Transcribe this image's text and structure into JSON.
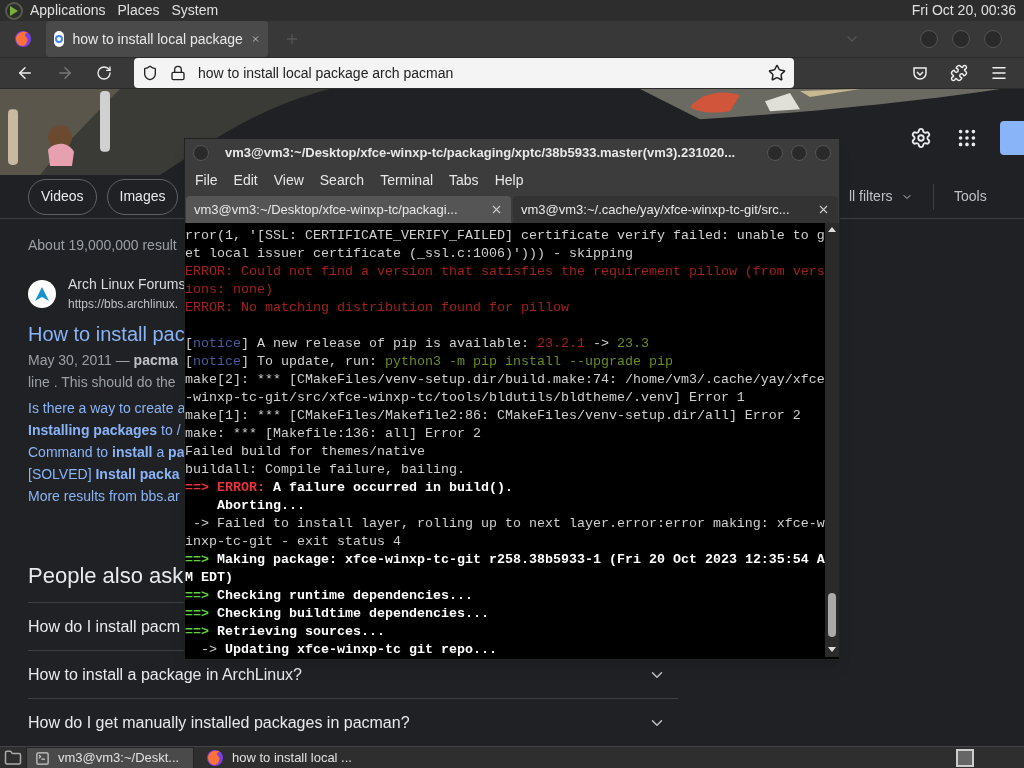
{
  "top_panel": {
    "menus": [
      "Applications",
      "Places",
      "System"
    ],
    "clock": "Fri Oct 20, 00:36"
  },
  "browser": {
    "tab": {
      "title": "how to install local package"
    },
    "address": {
      "value": "how to install local package arch pacman"
    },
    "search_tabs": [
      "Videos",
      "Images"
    ],
    "filters": [
      "ll filters",
      "Tools"
    ],
    "results_count": "About 19,000,000 result",
    "result": {
      "site": "Arch Linux Forums",
      "url": "https://bbs.archlinux.",
      "title": "How to install pac",
      "snippet": [
        "May 30, 2011 — **pacma**",
        "line . This should do the"
      ],
      "links": [
        "Is there a way to create a",
        "**Installing packages** to /",
        "Command to **install** a **pa**",
        "[SOLVED] **Install packa**",
        "More results from bbs.ar"
      ]
    },
    "people_also_ask": {
      "title": "People also ask",
      "questions": [
        {
          "text": "How do I install pacm",
          "chevron": false
        },
        {
          "text": "How to install a package in ArchLinux?",
          "chevron": true
        },
        {
          "text": "How do I get manually installed packages in pacman?",
          "chevron": true
        }
      ]
    }
  },
  "terminal": {
    "title": "vm3@vm3:~/Desktop/xfce-winxp-tc/packaging/xptc/38b5933.master(vm3).231020...",
    "menus": [
      "File",
      "Edit",
      "View",
      "Search",
      "Terminal",
      "Tabs",
      "Help"
    ],
    "tabs": [
      {
        "label": "vm3@vm3:~/Desktop/xfce-winxp-tc/packagi...",
        "selected": false
      },
      {
        "label": "vm3@vm3:~/.cache/yay/xfce-winxp-tc-git/src...",
        "selected": true
      }
    ],
    "blocks": [
      [
        [
          {
            "text": "rror(1, '[SSL: CERTIFICATE_VERIFY_FAILED] certificate verify failed: unable to g",
            "kind": "plain"
          }
        ],
        [
          {
            "text": "et local issuer certificate (_ssl.c:1006)'))) - skipping",
            "kind": "plain"
          }
        ],
        [
          {
            "text": "ERROR: Could not find a version that satisfies the requirement pillow (from vers",
            "kind": "error"
          }
        ],
        [
          {
            "text": "ions: none)",
            "kind": "error"
          }
        ],
        [
          {
            "text": "ERROR: No matching distribution found for pillow",
            "kind": "error"
          }
        ]
      ],
      [
        [
          {
            "text": "[",
            "kind": "plain"
          },
          {
            "text": "notice",
            "kind": "notice"
          },
          {
            "text": "] A new release of pip is available: ",
            "kind": "plain"
          },
          {
            "text": "23.2.1",
            "kind": "error"
          },
          {
            "text": " -> ",
            "kind": "plain"
          },
          {
            "text": "23.3",
            "kind": "command"
          }
        ],
        [
          {
            "text": "[",
            "kind": "plain"
          },
          {
            "text": "notice",
            "kind": "notice"
          },
          {
            "text": "] To update, run: ",
            "kind": "plain"
          },
          {
            "text": "python3 -m pip install --upgrade pip",
            "kind": "command"
          }
        ],
        [
          {
            "text": "make[2]: *** [CMakeFiles/venv-setup.dir/build.make:74: /home/vm3/.cache/yay/xfce",
            "kind": "plain"
          }
        ],
        [
          {
            "text": "-winxp-tc-git/src/xfce-winxp-tc/tools/bldutils/bldtheme/.venv] Error 1",
            "kind": "plain"
          }
        ],
        [
          {
            "text": "make[1]: *** [CMakeFiles/Makefile2:86: CMakeFiles/venv-setup.dir/all] Error 2",
            "kind": "plain"
          }
        ],
        [
          {
            "text": "make: *** [Makefile:136: all] Error 2",
            "kind": "plain"
          }
        ],
        [
          {
            "text": "Failed build for themes/native",
            "kind": "plain"
          }
        ],
        [
          {
            "text": "buildall: Compile failure, bailing.",
            "kind": "plain"
          }
        ],
        [
          {
            "text": "==>",
            "kind": "failarrow"
          },
          {
            "text": " ERROR:",
            "kind": "fail"
          },
          {
            "text": " A failure occurred in build().",
            "kind": "strong"
          }
        ],
        [
          {
            "text": "    Aborting...",
            "kind": "strong"
          }
        ],
        [
          {
            "text": " -> Failed to install layer, rolling up to next layer.error:error making: xfce-w",
            "kind": "plain"
          }
        ],
        [
          {
            "text": "inxp-tc-git - exit status 4",
            "kind": "plain"
          }
        ],
        [
          {
            "text": "==>",
            "kind": "arrow"
          },
          {
            "text": " Making package: xfce-winxp-tc-git r258.38b5933-1 (Fri 20 Oct 2023 12:35:54 A",
            "kind": "strong"
          }
        ],
        [
          {
            "text": "M EDT)",
            "kind": "strong"
          }
        ],
        [
          {
            "text": "==>",
            "kind": "arrow"
          },
          {
            "text": " Checking runtime dependencies...",
            "kind": "strong"
          }
        ],
        [
          {
            "text": "==>",
            "kind": "arrow"
          },
          {
            "text": " Checking buildtime dependencies...",
            "kind": "strong"
          }
        ],
        [
          {
            "text": "==>",
            "kind": "arrow"
          },
          {
            "text": " Retrieving sources...",
            "kind": "strong"
          }
        ],
        [
          {
            "text": "  -> ",
            "kind": "plain"
          },
          {
            "text": "Updating xfce-winxp-tc git repo...",
            "kind": "strong"
          }
        ]
      ]
    ]
  },
  "taskbar": {
    "items": [
      {
        "label": "vm3@vm3:~/Deskt...",
        "kind": "terminal",
        "selected": true
      },
      {
        "label": "how to install local ...",
        "kind": "browser",
        "selected": false
      }
    ]
  }
}
